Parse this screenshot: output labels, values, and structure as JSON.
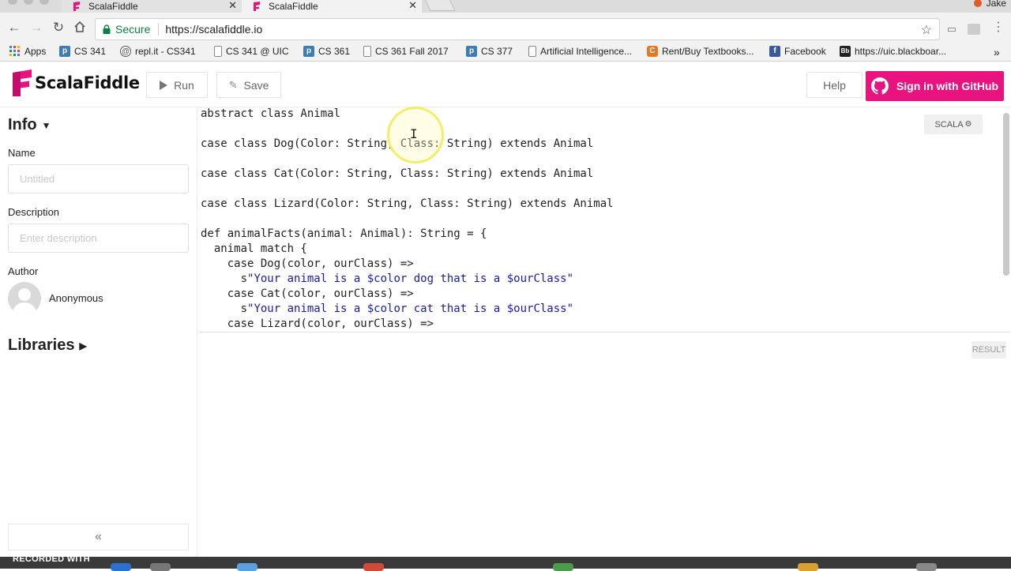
{
  "browser": {
    "tabs": [
      {
        "title": "ScalaFiddle",
        "active": false
      },
      {
        "title": "ScalaFiddle",
        "active": true
      }
    ],
    "profile": "Jake",
    "secure_label": "Secure",
    "url": "https://scalafiddle.io",
    "bookmarks": [
      {
        "label": "Apps",
        "icon": "apps-grid-icon"
      },
      {
        "label": "CS 341",
        "icon": "piazza-icon"
      },
      {
        "label": "repl.it - CS341",
        "icon": "replit-icon"
      },
      {
        "label": "CS 341 @ UIC",
        "icon": "page-icon"
      },
      {
        "label": "CS 361",
        "icon": "piazza-icon"
      },
      {
        "label": "CS 361 Fall 2017",
        "icon": "page-icon"
      },
      {
        "label": "CS 377",
        "icon": "piazza-icon"
      },
      {
        "label": "Artificial Intelligence...",
        "icon": "page-icon"
      },
      {
        "label": "Rent/Buy Textbooks...",
        "icon": "chegg-icon"
      },
      {
        "label": "Facebook",
        "icon": "facebook-icon"
      },
      {
        "label": "https://uic.blackboar...",
        "icon": "blackboard-icon"
      }
    ],
    "more_bookmarks": "»"
  },
  "app": {
    "logo_text": "ScalaFiddle",
    "run_label": "Run",
    "save_label": "Save",
    "help_label": "Help",
    "github_label": "Sign in with GitHub",
    "brand_color": "#e8137f"
  },
  "sidebar": {
    "info_title": "Info",
    "name_label": "Name",
    "name_placeholder": "Untitled",
    "description_label": "Description",
    "description_placeholder": "Enter description",
    "author_label": "Author",
    "author_name": "Anonymous",
    "libraries_title": "Libraries",
    "collapse_glyph": "«"
  },
  "editor": {
    "language_tag": "SCALA",
    "lines": [
      "abstract class Animal",
      "",
      "case class Dog(Color: String, Class: String) extends Animal",
      "",
      "case class Cat(Color: String, Class: String) extends Animal",
      "",
      "case class Lizard(Color: String, Class: String) extends Animal",
      "",
      "def animalFacts(animal: Animal): String = {",
      "  animal match {",
      "    case Dog(color, ourClass) =>",
      "      s\"Your animal is a $color dog that is a $ourClass\"",
      "    case Cat(color, ourClass) =>",
      "      s\"Your animal is a $color cat that is a $ourClass\"",
      "    case Lizard(color, ourClass) =>"
    ]
  },
  "result": {
    "tag": "RESULT"
  },
  "overlay": {
    "watermark": "RECORDED WITH"
  }
}
